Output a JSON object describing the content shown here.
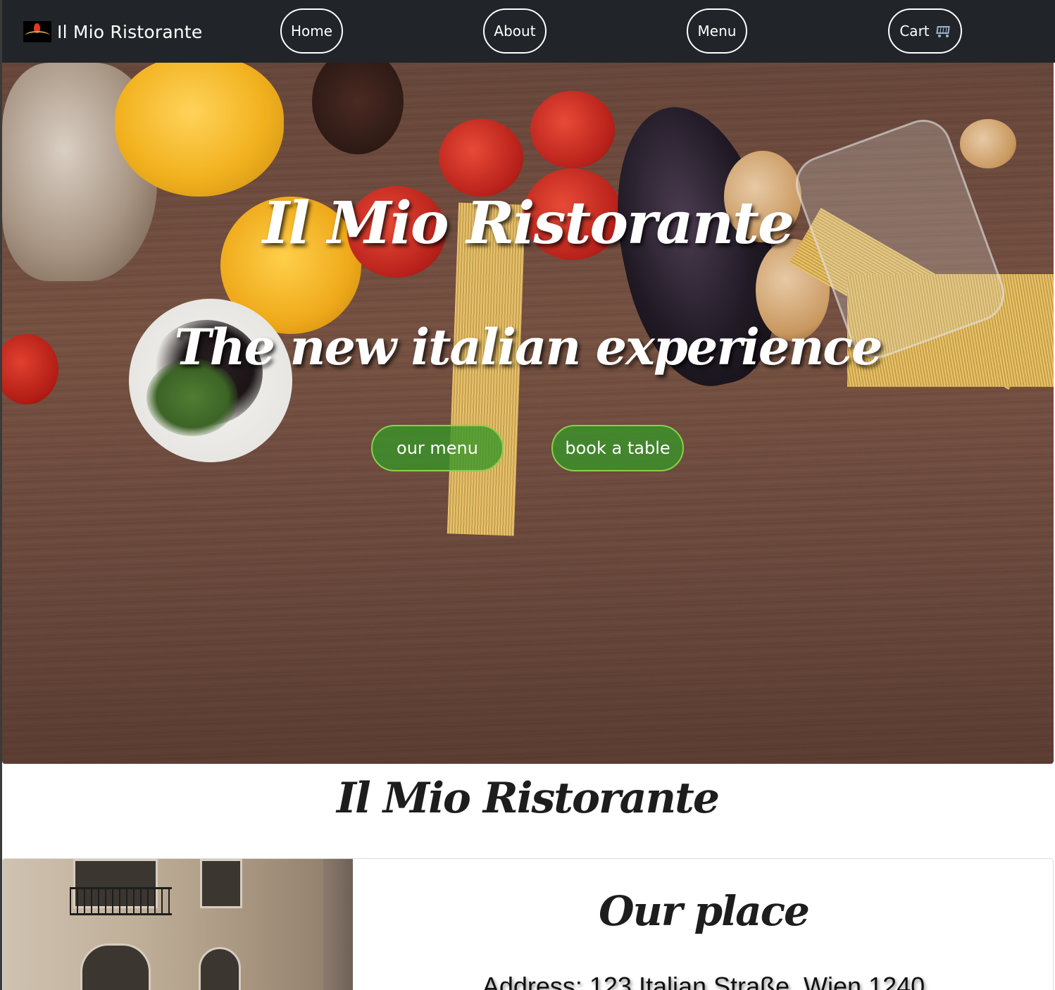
{
  "navbar": {
    "brand": "Il Mio Ristorante",
    "items": [
      {
        "label": "Home"
      },
      {
        "label": "About"
      },
      {
        "label": "Menu"
      },
      {
        "label": "Cart"
      }
    ],
    "icons": {
      "logo": "restaurant-logo-icon",
      "cart": "cart-icon"
    }
  },
  "hero": {
    "title": "Il Mio Ristorante",
    "subtitle": "The new italian experience",
    "buttons": {
      "menu": "our menu",
      "book": "book a table"
    },
    "accent_color": "#4a9e36"
  },
  "section": {
    "title": "Il Mio Ristorante",
    "card": {
      "title": "Our place",
      "address": "Address: 123 Italian Straße, Wien 1240"
    }
  },
  "colors": {
    "navbar_bg": "#212529",
    "text_dark": "#1d1d1d",
    "button_border": "#8ad04a"
  }
}
